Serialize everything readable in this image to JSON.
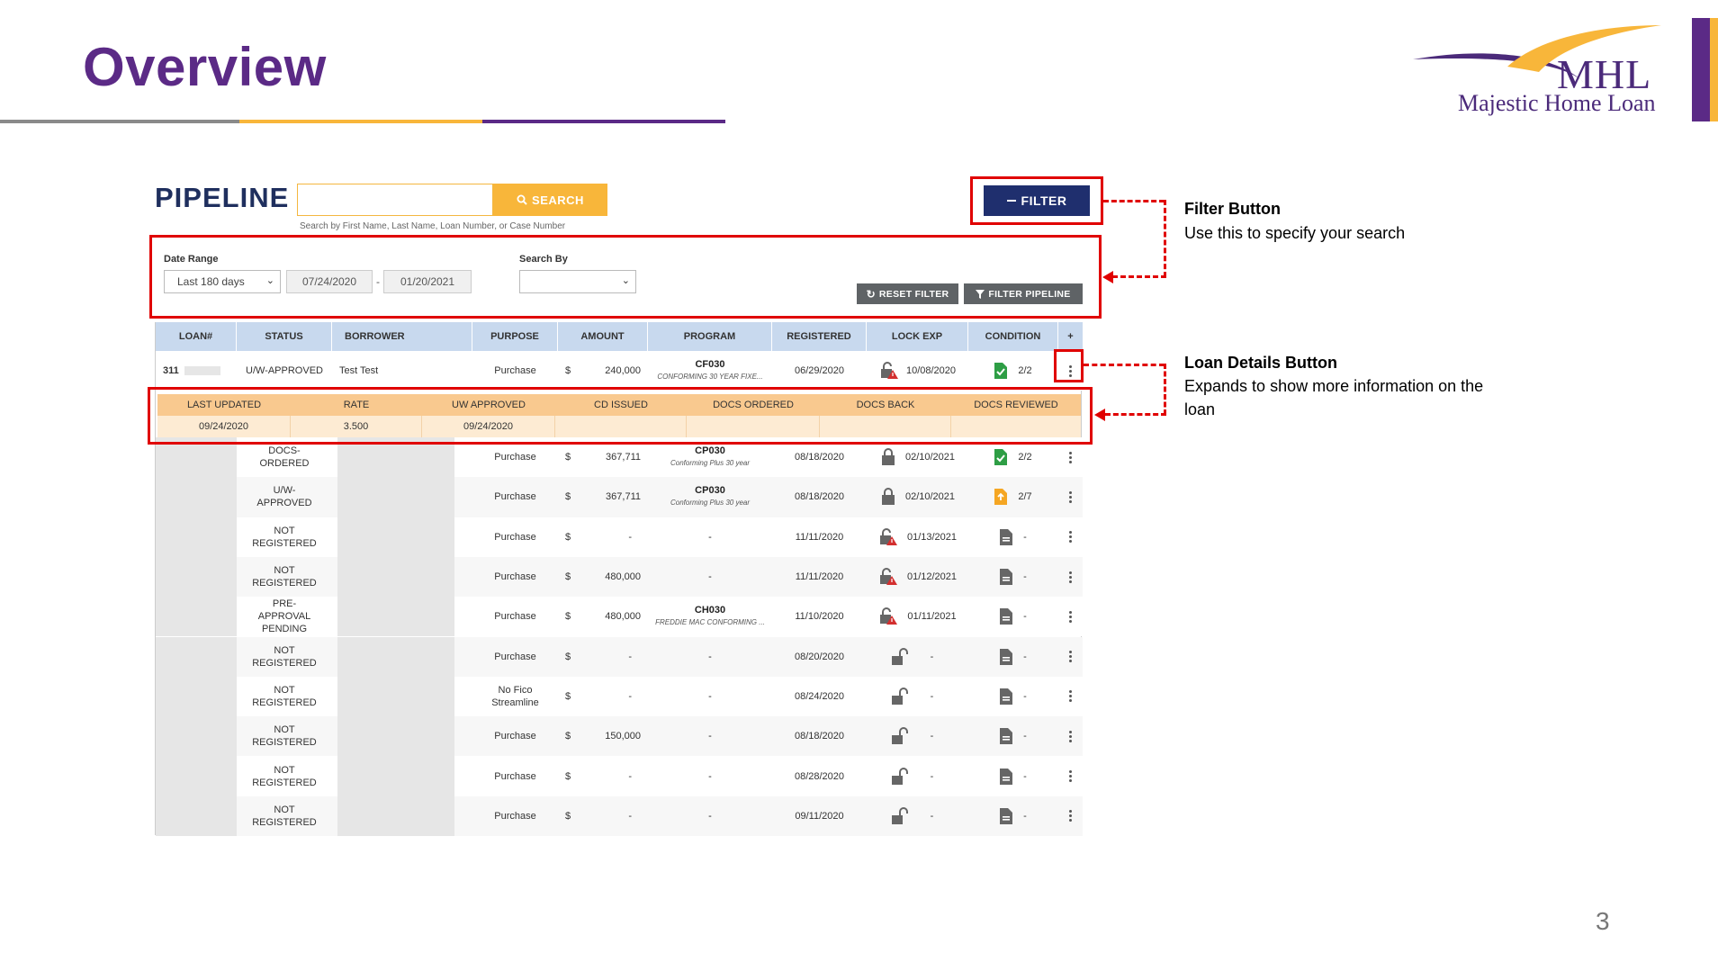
{
  "slide": {
    "title": "Overview",
    "page_number": "3",
    "colors": {
      "purple": "#5b2a86",
      "gold": "#f8b63a",
      "gray": "#8a8a8a",
      "red": "#e00000"
    }
  },
  "logo": {
    "main": "MHL",
    "sub": "Majestic Home Loan"
  },
  "pipeline": {
    "title": "PIPELINE",
    "search_placeholder": "",
    "search_button": "SEARCH",
    "search_hint": "Search by First Name, Last Name, Loan Number, or Case Number",
    "filter_button": "FILTER"
  },
  "filter_panel": {
    "date_range_label": "Date Range",
    "date_range_value": "Last 180 days",
    "date_from": "07/24/2020",
    "date_sep": "-",
    "date_to": "01/20/2021",
    "search_by_label": "Search By",
    "search_by_value": "",
    "reset_button": "RESET FILTER",
    "filter_pipeline_button": "FILTER PIPELINE"
  },
  "annotations": {
    "filter_title": "Filter Button",
    "filter_body": "Use this to specify your search",
    "details_title": "Loan Details Button",
    "details_body": "Expands to show more information on the loan"
  },
  "table": {
    "headers": [
      "LOAN#",
      "STATUS",
      "BORROWER",
      "PURPOSE",
      "AMOUNT",
      "PROGRAM",
      "REGISTERED",
      "LOCK EXP",
      "CONDITION",
      "+"
    ],
    "first_row": {
      "loan": "311",
      "status": "U/W-APPROVED",
      "borrower": "Test Test",
      "purpose": "Purchase",
      "currency": "$",
      "amount": "240,000",
      "program_code": "CF030",
      "program_desc": "CONFORMING 30 YEAR FIXE...",
      "registered": "06/29/2020",
      "lock_exp": "10/08/2020",
      "condition": "2/2"
    },
    "detail_headers": [
      "LAST UPDATED",
      "RATE",
      "UW APPROVED",
      "CD ISSUED",
      "DOCS ORDERED",
      "DOCS BACK",
      "DOCS REVIEWED"
    ],
    "detail_values": [
      "09/24/2020",
      "3.500",
      "09/24/2020",
      "",
      "",
      "",
      ""
    ],
    "rows": [
      {
        "status": "DOCS-ORDERED",
        "purpose": "Purchase",
        "currency": "$",
        "amount": "367,711",
        "program_code": "CP030",
        "program_desc": "Conforming Plus 30 year",
        "registered": "08/18/2020",
        "lock": "locked",
        "lock_exp": "02/10/2021",
        "cond_icon": "green",
        "condition": "2/2"
      },
      {
        "status": "U/W-APPROVED",
        "purpose": "Purchase",
        "currency": "$",
        "amount": "367,711",
        "program_code": "CP030",
        "program_desc": "Conforming Plus 30 year",
        "registered": "08/18/2020",
        "lock": "locked",
        "lock_exp": "02/10/2021",
        "cond_icon": "orange",
        "condition": "2/7"
      },
      {
        "status": "NOT REGISTERED",
        "purpose": "Purchase",
        "currency": "$",
        "amount": "-",
        "program_code": "-",
        "program_desc": "",
        "registered": "11/11/2020",
        "lock": "warn",
        "lock_exp": "01/13/2021",
        "cond_icon": "gray",
        "condition": "-"
      },
      {
        "status": "NOT REGISTERED",
        "purpose": "Purchase",
        "currency": "$",
        "amount": "480,000",
        "program_code": "-",
        "program_desc": "",
        "registered": "11/11/2020",
        "lock": "warn",
        "lock_exp": "01/12/2021",
        "cond_icon": "gray",
        "condition": "-"
      },
      {
        "status": "PRE-APPROVAL PENDING",
        "purpose": "Purchase",
        "currency": "$",
        "amount": "480,000",
        "program_code": "CH030",
        "program_desc": "FREDDIE MAC CONFORMING ...",
        "registered": "11/10/2020",
        "lock": "warn",
        "lock_exp": "01/11/2021",
        "cond_icon": "gray",
        "condition": "-"
      },
      {
        "status": "NOT REGISTERED",
        "purpose": "Purchase",
        "currency": "$",
        "amount": "-",
        "program_code": "-",
        "program_desc": "",
        "registered": "08/20/2020",
        "lock": "open",
        "lock_exp": "-",
        "cond_icon": "gray",
        "condition": "-"
      },
      {
        "status": "NOT REGISTERED",
        "purpose": "No Fico Streamline",
        "currency": "$",
        "amount": "-",
        "program_code": "-",
        "program_desc": "",
        "registered": "08/24/2020",
        "lock": "open",
        "lock_exp": "-",
        "cond_icon": "gray",
        "condition": "-"
      },
      {
        "status": "NOT REGISTERED",
        "purpose": "Purchase",
        "currency": "$",
        "amount": "150,000",
        "program_code": "-",
        "program_desc": "",
        "registered": "08/18/2020",
        "lock": "open",
        "lock_exp": "-",
        "cond_icon": "gray",
        "condition": "-"
      },
      {
        "status": "NOT REGISTERED",
        "purpose": "Purchase",
        "currency": "$",
        "amount": "-",
        "program_code": "-",
        "program_desc": "",
        "registered": "08/28/2020",
        "lock": "open",
        "lock_exp": "-",
        "cond_icon": "gray",
        "condition": "-"
      },
      {
        "status": "NOT REGISTERED",
        "purpose": "Purchase",
        "currency": "$",
        "amount": "-",
        "program_code": "-",
        "program_desc": "",
        "registered": "09/11/2020",
        "lock": "open",
        "lock_exp": "-",
        "cond_icon": "gray",
        "condition": "-"
      }
    ]
  }
}
